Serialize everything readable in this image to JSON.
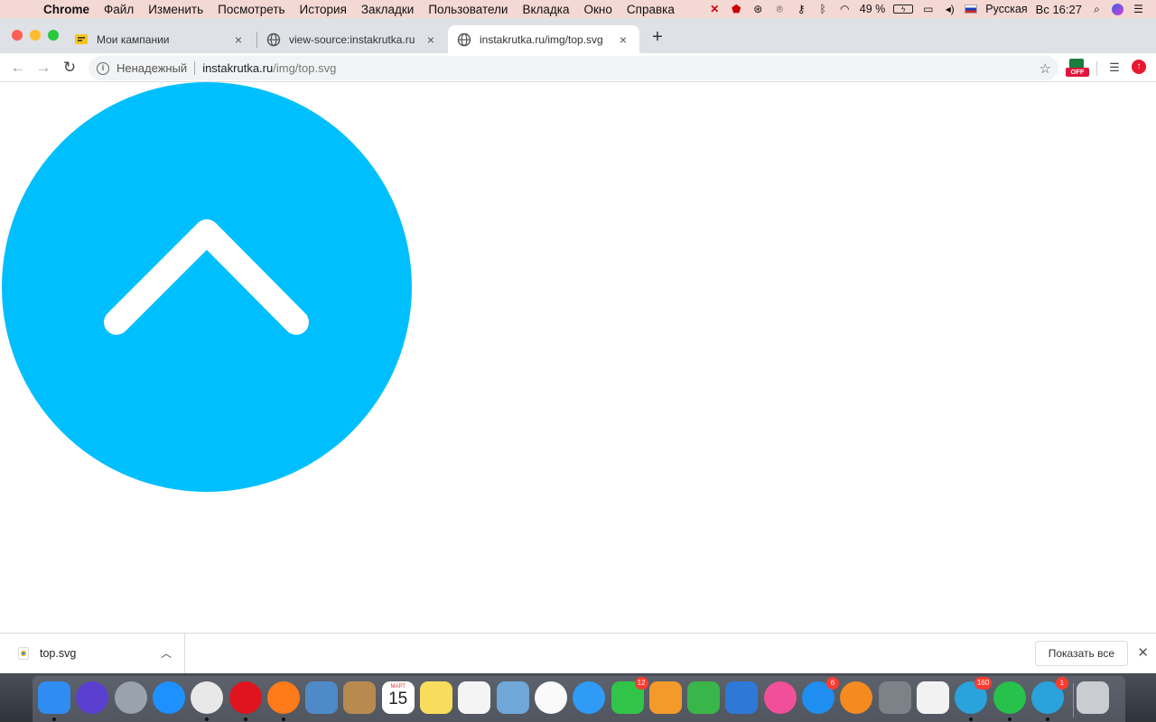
{
  "menubar": {
    "app_name": "Chrome",
    "items": [
      "Файл",
      "Изменить",
      "Посмотреть",
      "История",
      "Закладки",
      "Пользователи",
      "Вкладка",
      "Окно",
      "Справка"
    ],
    "battery": "49 %",
    "input_source": "Русская",
    "clock": "Вс 16:27",
    "status_icons": [
      "adblock-icon",
      "shield-badge-icon",
      "vpn-icon",
      "antenna-icon",
      "key-icon",
      "bluetooth-icon",
      "wifi-icon",
      "battery-icon",
      "airplay-icon",
      "volume-icon"
    ]
  },
  "tabs": [
    {
      "title": "Мои кампании",
      "favicon": "campaign-icon",
      "active": false
    },
    {
      "title": "view-source:instakrutka.ru",
      "favicon": "globe-icon",
      "active": false
    },
    {
      "title": "instakrutka.ru/img/top.svg",
      "favicon": "globe-icon",
      "active": true
    }
  ],
  "toolbar": {
    "security_label": "Ненадежный",
    "url_host": "instakrutka.ru",
    "url_path": "/img/top.svg",
    "ext_off_label": "OFF"
  },
  "content": {
    "circle_color": "#00bfff",
    "chevron_color": "#ffffff"
  },
  "download_bar": {
    "file_name": "top.svg",
    "show_all_label": "Показать все"
  },
  "dock": {
    "calendar_month": "МАРТ",
    "calendar_day": "15",
    "apps": [
      {
        "name": "finder",
        "color": "#2f8cf0",
        "badge": ""
      },
      {
        "name": "siri",
        "color": "#5b3fd1",
        "badge": ""
      },
      {
        "name": "launchpad",
        "color": "#9aa3ad",
        "badge": ""
      },
      {
        "name": "safari",
        "color": "#1e90ff",
        "badge": ""
      },
      {
        "name": "chrome",
        "color": "#e8e8e8",
        "badge": ""
      },
      {
        "name": "opera",
        "color": "#e0141e",
        "badge": ""
      },
      {
        "name": "firefox",
        "color": "#ff7a18",
        "badge": ""
      },
      {
        "name": "mail",
        "color": "#4e8ac8",
        "badge": ""
      },
      {
        "name": "contacts",
        "color": "#b98a4f",
        "badge": ""
      },
      {
        "name": "calendar",
        "color": "#ffffff",
        "badge": ""
      },
      {
        "name": "notes",
        "color": "#f7dd5b",
        "badge": ""
      },
      {
        "name": "reminders",
        "color": "#f4f4f4",
        "badge": ""
      },
      {
        "name": "preview",
        "color": "#6ea7d8",
        "badge": ""
      },
      {
        "name": "photos",
        "color": "#fafafa",
        "badge": ""
      },
      {
        "name": "messages",
        "color": "#2f9bf7",
        "badge": ""
      },
      {
        "name": "facetime",
        "color": "#30c548",
        "badge": "12"
      },
      {
        "name": "pages",
        "color": "#f39a2b",
        "badge": ""
      },
      {
        "name": "numbers",
        "color": "#3ab54a",
        "badge": ""
      },
      {
        "name": "keynote",
        "color": "#2e79d8",
        "badge": ""
      },
      {
        "name": "itunes",
        "color": "#f24f9a",
        "badge": ""
      },
      {
        "name": "app-store",
        "color": "#1f8ef1",
        "badge": "6"
      },
      {
        "name": "books",
        "color": "#f58b1f",
        "badge": ""
      },
      {
        "name": "system-preferences",
        "color": "#7d8289",
        "badge": ""
      },
      {
        "name": "textedit",
        "color": "#f2f2f2",
        "badge": ""
      },
      {
        "name": "telegram",
        "color": "#2aa2dc",
        "badge": "160"
      },
      {
        "name": "whatsapp",
        "color": "#27c24c",
        "badge": ""
      },
      {
        "name": "telegram-2",
        "color": "#2aa2dc",
        "badge": "1"
      },
      {
        "name": "trash",
        "color": "#c9ccd0",
        "badge": ""
      }
    ]
  }
}
